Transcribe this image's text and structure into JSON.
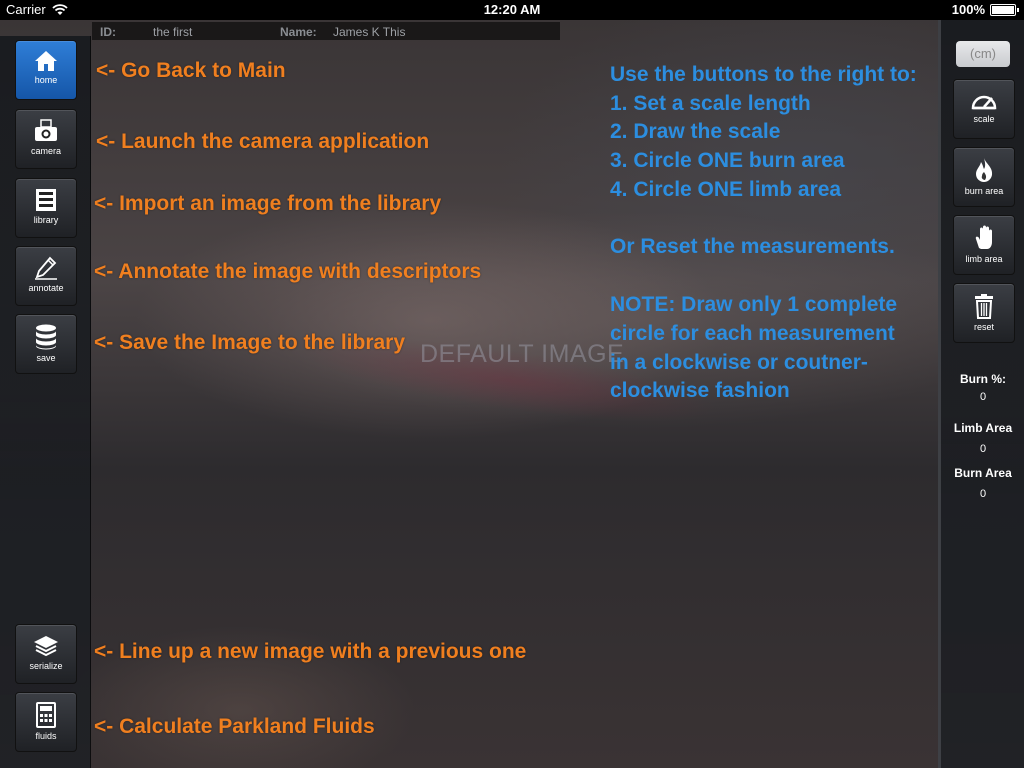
{
  "status_bar": {
    "carrier": "Carrier",
    "time": "12:20 AM",
    "battery": "100%"
  },
  "info": {
    "id_label": "ID:",
    "id_value": "the first",
    "name_label": "Name:",
    "name_value": "James K This"
  },
  "left_toolbar": [
    {
      "label": "home",
      "icon": "home-icon"
    },
    {
      "label": "camera",
      "icon": "camera-icon"
    },
    {
      "label": "library",
      "icon": "library-icon"
    },
    {
      "label": "annotate",
      "icon": "pen-icon"
    },
    {
      "label": "save",
      "icon": "database-icon"
    },
    {
      "label": "serialize",
      "icon": "layers-icon"
    },
    {
      "label": "fluids",
      "icon": "calculator-icon"
    }
  ],
  "annotations": {
    "home": "<- Go Back to Main",
    "camera": "<- Launch the camera application",
    "library": "<- Import an image from the library",
    "annotate": "<- Annotate the image with descriptors",
    "save": "<- Save the Image to the library",
    "serialize": "<- Line up a new image with a previous one",
    "fluids": "<- Calculate Parkland Fluids"
  },
  "instructions": [
    "Use the buttons to the right to:",
    "1. Set a scale length",
    "2. Draw the scale",
    "3. Circle ONE burn area",
    "4. Circle ONE limb area",
    "Or Reset the measurements.",
    "NOTE: Draw only 1 complete",
    "circle for each measurement",
    "in a clockwise or coutner-",
    "clockwise fashion"
  ],
  "placeholder_text": "DEFAULT IMAGE",
  "right_toolbar": {
    "unit_field": "(cm)",
    "buttons": [
      {
        "label": "scale",
        "icon": "gauge-icon"
      },
      {
        "label": "burn area",
        "icon": "flame-icon"
      },
      {
        "label": "limb area",
        "icon": "hand-icon"
      },
      {
        "label": "reset",
        "icon": "trash-icon"
      }
    ],
    "stats": [
      {
        "label": "Burn %:",
        "value": "0"
      },
      {
        "label": "Limb Area",
        "value": "0"
      },
      {
        "label": "Burn Area",
        "value": "0"
      }
    ]
  },
  "colors": {
    "annotation": "#f07f1f",
    "instruction": "#2c8ee0",
    "active_button": "#2f7ed7"
  }
}
